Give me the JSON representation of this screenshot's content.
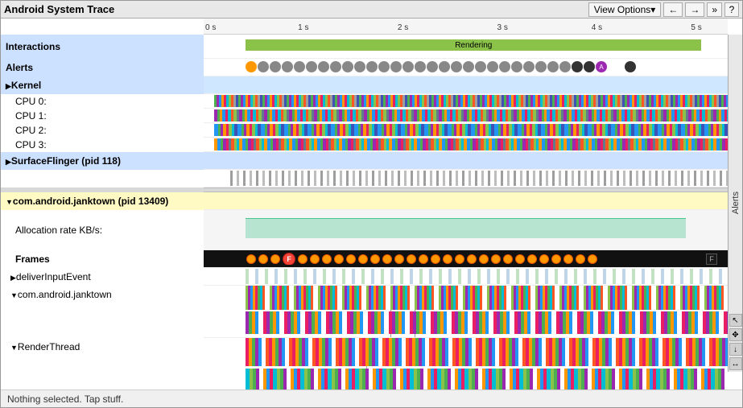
{
  "titleBar": {
    "title": "Android System Trace",
    "viewOptions": "View Options▾",
    "navLeft": "←",
    "navRight": "→",
    "navDouble": "»",
    "help": "?"
  },
  "timeline": {
    "ticks": [
      "0 s",
      "1 s",
      "2 s",
      "3 s",
      "4 s",
      "5 s"
    ]
  },
  "sections": {
    "interactions": "Interactions",
    "alerts": "Alerts",
    "kernel": "Kernel",
    "cpu0": "CPU 0:",
    "cpu1": "CPU 1:",
    "cpu2": "CPU 2:",
    "cpu3": "CPU 3:",
    "surfaceFlinger": "SurfaceFlinger (pid 118)",
    "janktown": "com.android.janktown (pid 13409)",
    "allocationRate": "Allocation rate KB/s:",
    "frames": "Frames",
    "deliverInputEvent": "deliverInputEvent",
    "comAndroidJanktown": "com.android.janktown",
    "renderThread": "RenderThread"
  },
  "tracks": {
    "rendering": "Rendering"
  },
  "statusBar": {
    "message": "Nothing selected. Tap stuff."
  },
  "alerts": "Alerts"
}
